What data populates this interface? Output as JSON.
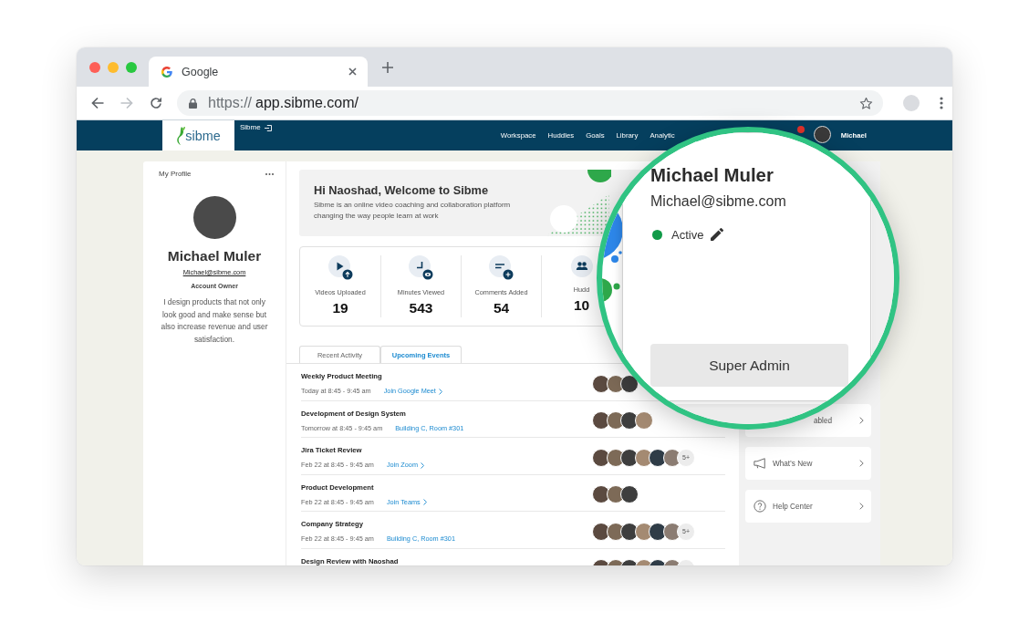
{
  "browser": {
    "tab_title": "Google",
    "url_scheme": "https://",
    "url_host": "app.sibme.com/",
    "forward_disabled": true
  },
  "navbar": {
    "logo_text": "sibme",
    "account_label": "Sibme",
    "links": [
      {
        "label": "Workspace"
      },
      {
        "label": "Huddles"
      },
      {
        "label": "Goals"
      },
      {
        "label": "Library"
      },
      {
        "label": "Analytic"
      }
    ],
    "unread_notifications": true,
    "user_name": "Michael"
  },
  "profile": {
    "heading": "My Profile",
    "name": "Michael Muler",
    "email": "Michael@sibme.com",
    "role": "Account Owner",
    "bio": "I design products that not only look good and make sense but also increase revenue and user satisfaction."
  },
  "welcome": {
    "title": "Hi Naoshad, Welcome to Sibme",
    "text": "Sibme is an online video coaching and collaboration platform changing the way people learn at work"
  },
  "stats": [
    {
      "kind": "video",
      "label": "Videos Uploaded",
      "value": "19"
    },
    {
      "kind": "clock",
      "label": "Minutes Viewed",
      "value": "543"
    },
    {
      "kind": "comment",
      "label": "Comments Added",
      "value": "54"
    },
    {
      "kind": "people",
      "label": "Hudd",
      "value": "10"
    }
  ],
  "activity_tabs": [
    {
      "label": "Recent Activity",
      "selected": false
    },
    {
      "label": "Upcoming Events",
      "selected": true
    }
  ],
  "events": [
    {
      "title": "Weekly Product Meeting",
      "time": "Today at 8:45 - 9:45 am",
      "link": {
        "kind": "join",
        "label": "Join Google Meet"
      },
      "attendees": [
        {
          "kind": "photo"
        },
        {
          "kind": "photo"
        },
        {
          "kind": "photo"
        }
      ]
    },
    {
      "title": "Development of Design System",
      "time": "Tomorrow at 8:45 - 9:45 am",
      "link": {
        "kind": "place",
        "label": "Building C, Room #301"
      },
      "attendees": [
        {
          "kind": "photo"
        },
        {
          "kind": "photo"
        },
        {
          "kind": "photo"
        },
        {
          "kind": "photo"
        }
      ]
    },
    {
      "title": "Jira Ticket Review",
      "time": "Feb 22 at 8:45 - 9:45 am",
      "link": {
        "kind": "join",
        "label": "Join Zoom"
      },
      "attendees": [
        {
          "kind": "photo"
        },
        {
          "kind": "photo"
        },
        {
          "kind": "photo"
        },
        {
          "kind": "photo"
        },
        {
          "kind": "photo"
        },
        {
          "kind": "photo"
        },
        {
          "kind": "more",
          "label": "5+"
        }
      ]
    },
    {
      "title": "Product Development",
      "time": "Feb 22 at 8:45 - 9:45 am",
      "link": {
        "kind": "join",
        "label": "Join Teams"
      },
      "attendees": [
        {
          "kind": "photo"
        },
        {
          "kind": "photo"
        },
        {
          "kind": "photo"
        }
      ]
    },
    {
      "title": "Company Strategy",
      "time": "Feb 22 at 8:45 - 9:45 am",
      "link": {
        "kind": "place",
        "label": "Building C, Room #301"
      },
      "attendees": [
        {
          "kind": "photo"
        },
        {
          "kind": "photo"
        },
        {
          "kind": "photo"
        },
        {
          "kind": "photo"
        },
        {
          "kind": "photo"
        },
        {
          "kind": "photo"
        },
        {
          "kind": "more",
          "label": "5+"
        }
      ]
    },
    {
      "title": "Design Review with Naoshad",
      "attendees": [
        {
          "kind": "photo"
        },
        {
          "kind": "photo"
        },
        {
          "kind": "photo"
        },
        {
          "kind": "photo"
        },
        {
          "kind": "photo"
        },
        {
          "kind": "photo"
        },
        {
          "kind": "more"
        }
      ]
    }
  ],
  "side_cards": [
    {
      "kind": "plain",
      "label": "abled"
    },
    {
      "kind": "megaphone",
      "label": "What’s New"
    },
    {
      "kind": "help",
      "label": "Help Center"
    }
  ],
  "magnifier": {
    "name": "Michael Muler",
    "email": "Michael@sibme.com",
    "status": {
      "label": "Active",
      "active": true
    },
    "role_button": "Super Admin"
  }
}
